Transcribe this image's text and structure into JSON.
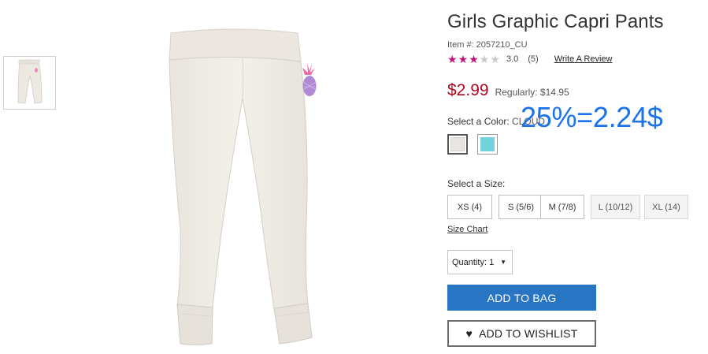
{
  "product": {
    "title": "Girls Graphic Capri Pants",
    "item_number": "Item #: 2057210_CU",
    "rating": {
      "value_label": "3.0",
      "stars_filled": 3,
      "stars_total": 5,
      "count_label": "(5)",
      "review_link": "Write A Review"
    },
    "price": {
      "sale": "$2.99",
      "regular": "Regularly: $14.95"
    }
  },
  "color": {
    "label": "Select a Color:",
    "selected_name": "CLOUD",
    "swatches": [
      {
        "name": "cloud",
        "hex": "#e8e4df",
        "selected": true
      },
      {
        "name": "aqua",
        "hex": "#72d3df",
        "selected": false
      }
    ]
  },
  "overlay_annotation": "25%=2.24$",
  "size": {
    "label": "Select a Size:",
    "options": [
      {
        "label": "XS (4)",
        "available": true
      },
      {
        "label": "S (5/6)",
        "available": true
      },
      {
        "label": "M (7/8)",
        "available": true
      },
      {
        "label": "L (10/12)",
        "available": false
      },
      {
        "label": "XL (14)",
        "available": false
      }
    ],
    "chart_link": "Size Chart"
  },
  "quantity": {
    "label": "Quantity: 1",
    "caret_icon": "caret-down-icon"
  },
  "actions": {
    "add_to_bag": "ADD TO BAG",
    "add_to_wishlist": "ADD TO WISHLIST",
    "wishlist_icon": "heart-icon"
  },
  "colors": {
    "sale_price": "#b00720",
    "star_on": "#c0157d",
    "primary_button": "#2875c3",
    "overlay_text": "#1a73e8"
  }
}
